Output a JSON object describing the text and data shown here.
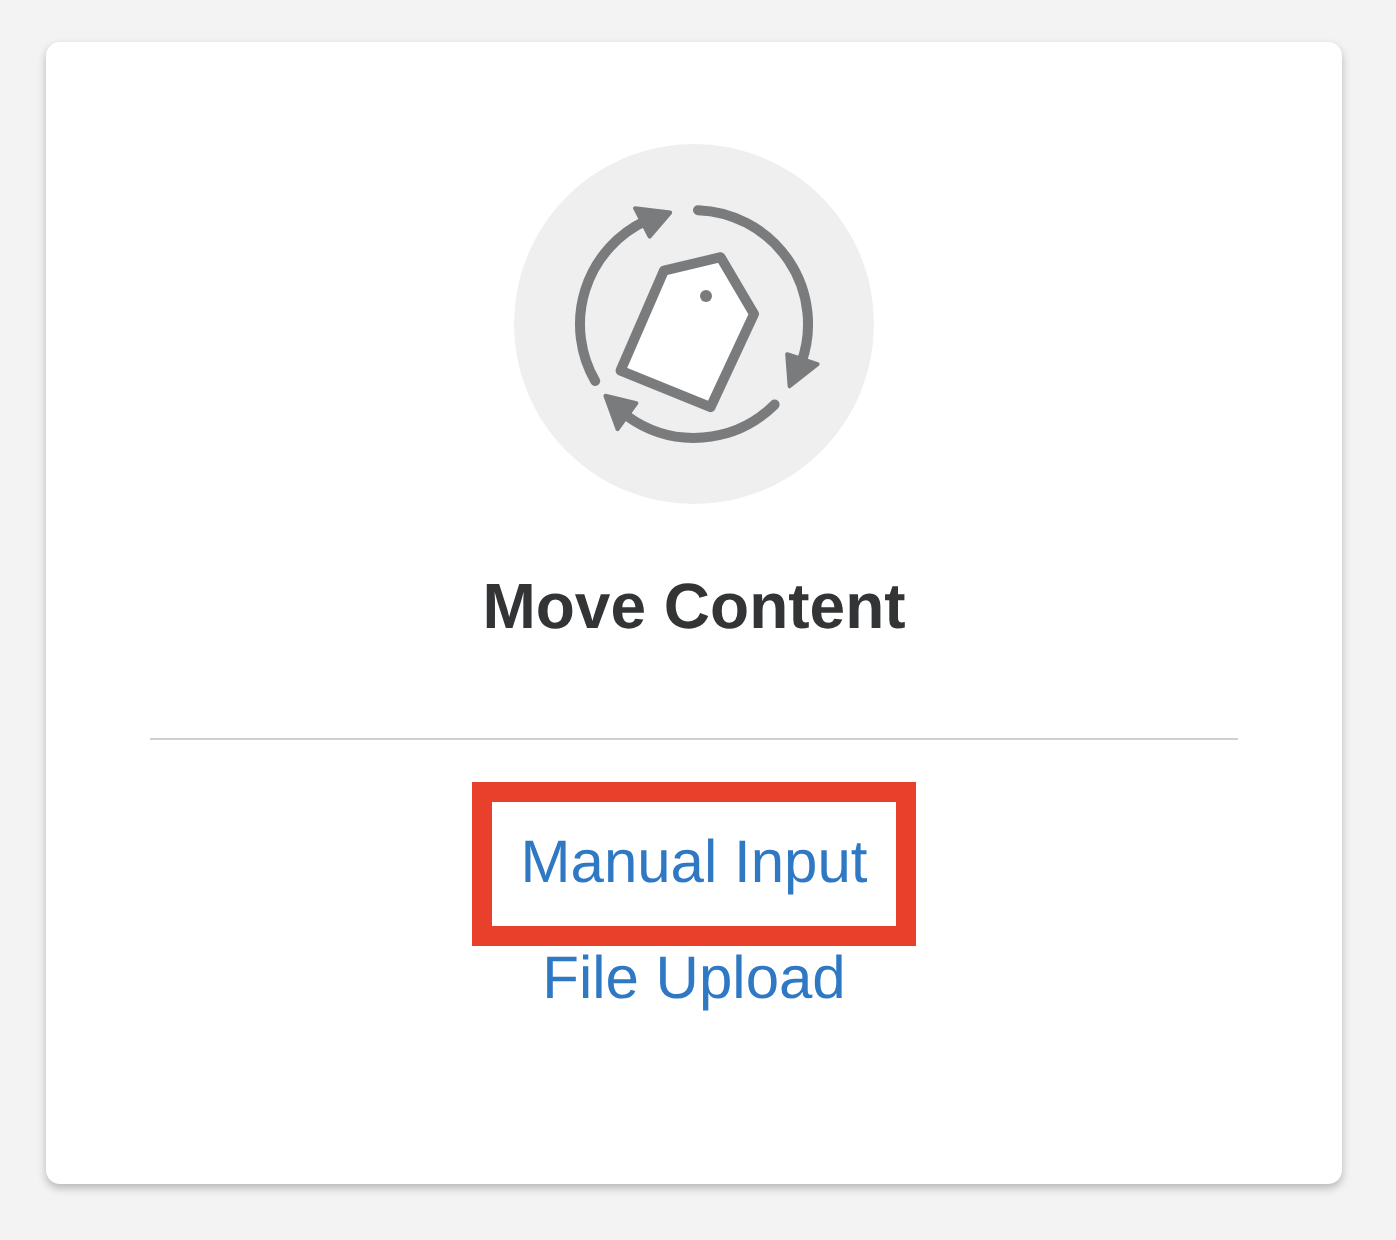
{
  "card": {
    "title": "Move Content",
    "links": [
      {
        "label": "Manual Input",
        "highlighted": true
      },
      {
        "label": "File Upload",
        "highlighted": false
      }
    ]
  }
}
